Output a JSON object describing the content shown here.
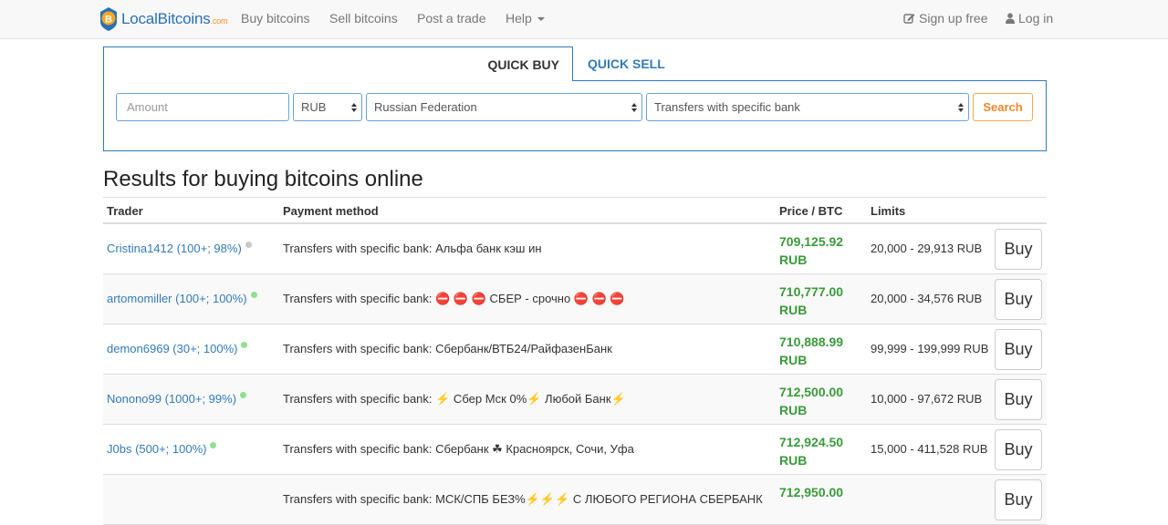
{
  "brand": {
    "name": "LocalBitcoins",
    "domain": ".com"
  },
  "nav": {
    "buy": "Buy bitcoins",
    "sell": "Sell bitcoins",
    "post": "Post a trade",
    "help": "Help",
    "signup": "Sign up free",
    "login": "Log in"
  },
  "quick": {
    "tab_buy": "QUICK BUY",
    "tab_sell": "QUICK SELL",
    "amount_placeholder": "Amount",
    "currency": "RUB",
    "country": "Russian Federation",
    "method": "Transfers with specific bank",
    "search": "Search"
  },
  "results": {
    "title": "Results for buying bitcoins online",
    "headers": {
      "trader": "Trader",
      "payment": "Payment method",
      "price": "Price / BTC",
      "limits": "Limits"
    },
    "buy_label": "Buy",
    "rows": [
      {
        "trader": "Cristina1412 (100+; 98%)",
        "status": "grey",
        "payment": "Transfers with specific bank: Альфа банк кэш ин",
        "price": "709,125.92",
        "currency": "RUB",
        "limits": "20,000 - 29,913 RUB"
      },
      {
        "trader": "artomomiller (100+; 100%)",
        "status": "green",
        "payment": "Transfers with specific bank: ⛔ ⛔ ⛔  СБЕР - срочно ⛔ ⛔ ⛔",
        "price": "710,777.00",
        "currency": "RUB",
        "limits": "20,000 - 34,576 RUB"
      },
      {
        "trader": "demon6969 (30+; 100%)",
        "status": "green",
        "payment": "Transfers with specific bank: Сбербанк/ВТБ24/РайфазенБанк",
        "price": "710,888.99",
        "currency": "RUB",
        "limits": "99,999 - 199,999 RUB"
      },
      {
        "trader": "Nonono99 (1000+; 99%)",
        "status": "green",
        "payment": "Transfers with specific bank: ⚡ Сбер Мск 0%⚡ Любой Банк⚡",
        "price": "712,500.00",
        "currency": "RUB",
        "limits": "10,000 - 97,672 RUB"
      },
      {
        "trader": "J0bs (500+; 100%)",
        "status": "green",
        "payment": "Transfers with specific bank: Сбербанк ☘  Красноярск, Сочи, Уфа",
        "price": "712,924.50",
        "currency": "RUB",
        "limits": "15,000 - 411,528 RUB"
      },
      {
        "trader": "",
        "status": "none",
        "payment": "Transfers with specific bank: МСК/СПБ БЕЗ%⚡⚡⚡ С ЛЮБОГО РЕГИОНА СБЕРБАНК",
        "price": "712,950.00",
        "currency": "",
        "limits": ""
      }
    ]
  },
  "colors": {
    "link": "#337ab7",
    "price": "#3a9a3a",
    "status_green": "#8fe08f",
    "status_grey": "#c8c8c8",
    "accent": "#f0882c"
  }
}
